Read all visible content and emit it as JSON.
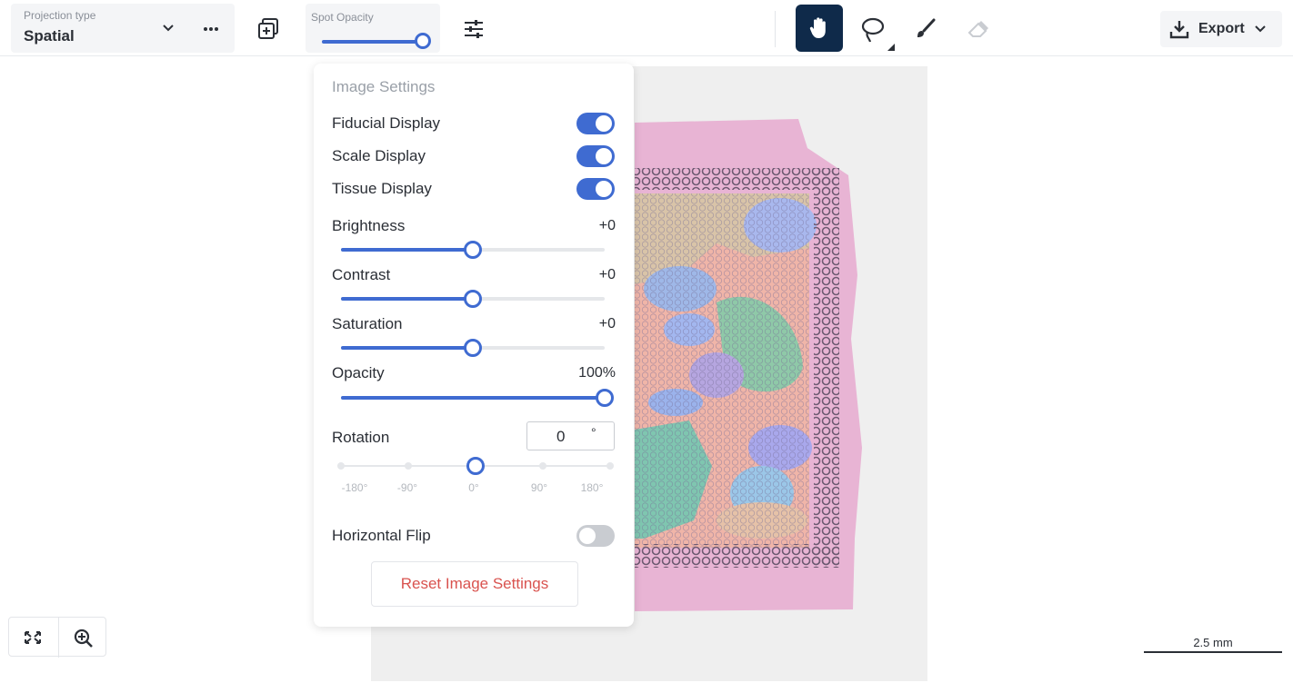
{
  "toolbar": {
    "projection_label": "Projection type",
    "projection_value": "Spatial",
    "spot_opacity_label": "Spot Opacity",
    "spot_opacity_level": 1.0,
    "export_label": "Export",
    "active_tool": "hand",
    "icons": [
      "chevron-down-icon",
      "more-icon",
      "layers-icon",
      "filter-sliders-icon",
      "hand-icon",
      "lasso-icon",
      "brush-icon",
      "eraser-icon",
      "download-icon"
    ]
  },
  "panel": {
    "title": "Image Settings",
    "toggles": [
      {
        "label": "Fiducial Display",
        "on": true
      },
      {
        "label": "Scale Display",
        "on": true
      },
      {
        "label": "Tissue Display",
        "on": true
      }
    ],
    "sliders": [
      {
        "label": "Brightness",
        "value": "+0",
        "level": 0.5
      },
      {
        "label": "Contrast",
        "value": "+0",
        "level": 0.5
      },
      {
        "label": "Saturation",
        "value": "+0",
        "level": 0.5
      },
      {
        "label": "Opacity",
        "value": "100%",
        "level": 1.0
      }
    ],
    "rotation": {
      "label": "Rotation",
      "value": "0",
      "unit": "°",
      "ticks": [
        "-180°",
        "-90°",
        "0°",
        "90°",
        "180°"
      ],
      "level": 0.5
    },
    "horizontal_flip": {
      "label": "Horizontal Flip",
      "on": false
    },
    "reset_label": "Reset Image Settings"
  },
  "scale_bar": {
    "label": "2.5 mm"
  },
  "colors": {
    "accent": "#3f6bd1",
    "active_tool_bg": "#0f2a4a",
    "reset_text": "#d9534f"
  }
}
